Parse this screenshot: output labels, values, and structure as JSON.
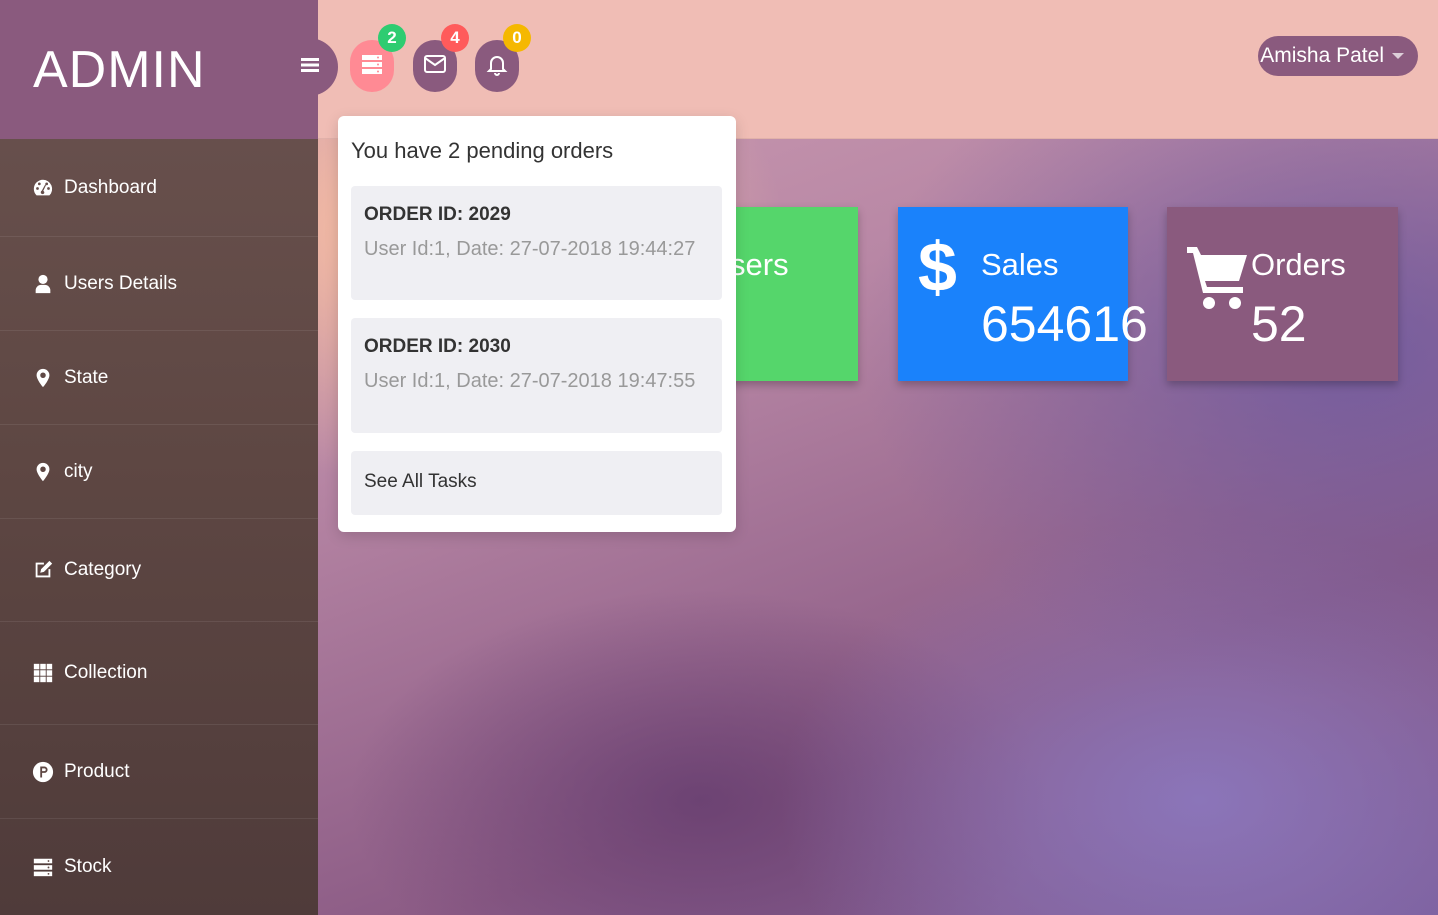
{
  "brand": {
    "title": "ADMIN"
  },
  "sidebar": {
    "items": [
      {
        "label": "Dashboard",
        "icon": "dashboard-icon"
      },
      {
        "label": "Users Details",
        "icon": "user-icon"
      },
      {
        "label": "State",
        "icon": "map-marker-icon"
      },
      {
        "label": "city",
        "icon": "map-marker-icon"
      },
      {
        "label": "Category",
        "icon": "edit-icon"
      },
      {
        "label": "Collection",
        "icon": "grid-icon"
      },
      {
        "label": "Product",
        "icon": "product-p-icon"
      },
      {
        "label": "Stock",
        "icon": "server-icon"
      }
    ]
  },
  "topbar": {
    "orders_badge": "2",
    "messages_badge": "4",
    "notifications_badge": "0",
    "user_name": "Amisha Patel",
    "colors": {
      "orders": "#ff8a94",
      "messages": "#8a5a7e",
      "notifications": "#8a5a7e",
      "badge_green": "#2ecc71",
      "badge_red": "#ff5b5b",
      "badge_yellow": "#f5b800"
    }
  },
  "dropdown": {
    "header": "You have 2 pending orders",
    "orders": [
      {
        "id": "ORDER ID: 2029",
        "meta": "User Id:1, Date: 27-07-2018 19:44:27"
      },
      {
        "id": "ORDER ID: 2030",
        "meta": "User Id:1, Date: 27-07-2018 19:47:55"
      }
    ],
    "see_all": "See All Tasks"
  },
  "cards": {
    "users": {
      "label": "sers",
      "color": "#55d66b"
    },
    "sales": {
      "label": "Sales",
      "value": "654616",
      "color": "#1a82fb",
      "icon": "dollar-icon"
    },
    "orders": {
      "label": "Orders",
      "value": "52",
      "color": "#8a5a7e",
      "icon": "cart-icon"
    }
  }
}
